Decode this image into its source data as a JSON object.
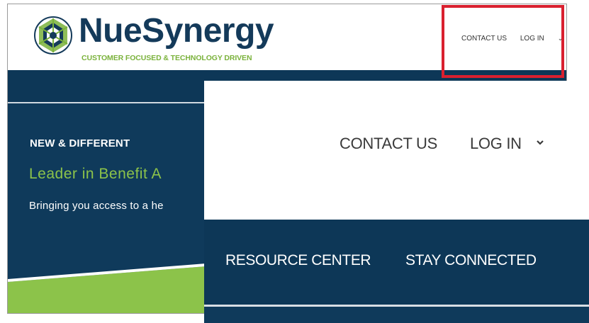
{
  "brand": {
    "name": "NueSynergy",
    "tagline": "CUSTOMER FOCUSED & TECHNOLOGY DRIVEN",
    "logo_icon": "geometric-sphere-logo",
    "colors": {
      "navy": "#0f3a5b",
      "green": "#8cc34a",
      "highlight": "#d9202f"
    }
  },
  "header_nav": {
    "contact_label": "CONTACT US",
    "login_label": "LOG IN"
  },
  "hero": {
    "kicker": "NEW & DIFFERENT",
    "title": "Leader in  Benefit A",
    "subtitle": "Bringing you access to a he"
  },
  "zoomed": {
    "contact_label": "CONTACT US",
    "login_label": "LOG IN",
    "nav_items": [
      {
        "label": "RESOURCE CENTER"
      },
      {
        "label": "STAY CONNECTED"
      }
    ]
  }
}
